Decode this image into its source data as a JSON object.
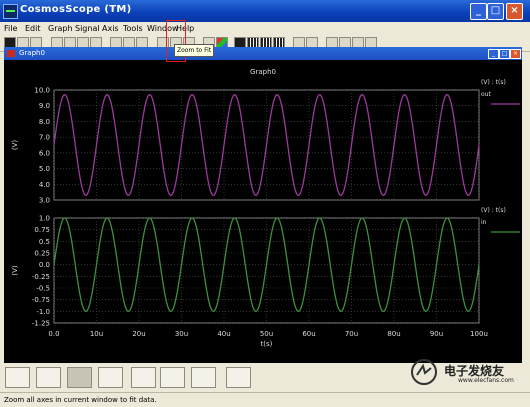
{
  "app": {
    "title": "CosmosScope (TM)"
  },
  "menu": [
    "File",
    "Edit",
    "Graph",
    "Signal",
    "Axis",
    "Tools",
    "Window",
    "Help"
  ],
  "toolbar": {
    "tooltip": "Zoom to Fit",
    "icons": [
      "select-icon",
      "measure-icon",
      "target-icon",
      "open-folder-icon",
      "reload-icon",
      "save-icon",
      "print-icon",
      "cut-icon",
      "copy-icon",
      "paste-icon",
      "zoom-in-icon",
      "zoom-fit-icon",
      "zoom-out-icon",
      "layout-icon",
      "color-icon",
      "grid-icon",
      "grid-icon",
      "grid-icon",
      "grid-icon",
      "fit-x-icon",
      "fit-y-icon",
      "stack-icon",
      "analog-icon",
      "digital-icon",
      "stack-mode-icon"
    ]
  },
  "document": {
    "title": "Graph0"
  },
  "status": {
    "text": "Zoom all axes in current window to fit data."
  },
  "bottom_tools": [
    "keyboard-icon",
    "pen-icon",
    "waveform-icon",
    "calculator-waveform-icon",
    "calculator-icon",
    "signal-manager-icon",
    "schematic-icon",
    "matlab-icon"
  ],
  "watermark": {
    "text": "电子发烧友",
    "sub": "www.elecfans.com"
  },
  "colors": {
    "top_trace": "#9b3a9b",
    "bottom_trace": "#3f8f3f",
    "grid": "#505050",
    "axis_text": "#dcdcdc"
  },
  "chart_data": [
    {
      "type": "line",
      "title": "Graph0",
      "legend_header": "(V) : t(s)",
      "series": [
        {
          "name": "out",
          "x_range": [
            0,
            100
          ],
          "mean": 6.5,
          "amplitude": 3.2,
          "cycles": 10,
          "phase_at_zero": "mid-rising"
        }
      ],
      "ylabel": "(V)",
      "ylim": [
        3.0,
        10.0
      ],
      "yticks": [
        "10.0",
        "9.0",
        "8.0",
        "7.0",
        "6.0",
        "5.0",
        "4.0",
        "3.0"
      ],
      "ytick_values": [
        10,
        9,
        8,
        7,
        6,
        5,
        4,
        3
      ],
      "grid": true,
      "legend_position": "right"
    },
    {
      "type": "line",
      "legend_header": "(V) : t(s)",
      "series": [
        {
          "name": "in",
          "x_range": [
            0,
            100
          ],
          "mean": 0,
          "amplitude": 1.0,
          "cycles": 10,
          "phase_at_zero": "mid-rising"
        }
      ],
      "ylabel": "(V)",
      "ylim": [
        -1.25,
        1.0
      ],
      "yticks": [
        "1.0",
        "0.75",
        "0.5",
        "0.25",
        "0.0",
        "-0.25",
        "-0.5",
        "-0.75",
        "-1.0",
        "-1.25"
      ],
      "ytick_values": [
        1,
        0.75,
        0.5,
        0.25,
        0,
        -0.25,
        -0.5,
        -0.75,
        -1,
        -1.25
      ],
      "xlabel": "t(s)",
      "xlim": [
        0,
        100
      ],
      "xticks": [
        "0.0",
        "10u",
        "20u",
        "30u",
        "40u",
        "50u",
        "60u",
        "70u",
        "80u",
        "90u",
        "100u"
      ],
      "xtick_values": [
        0,
        10,
        20,
        30,
        40,
        50,
        60,
        70,
        80,
        90,
        100
      ],
      "grid": true,
      "legend_position": "right"
    }
  ]
}
